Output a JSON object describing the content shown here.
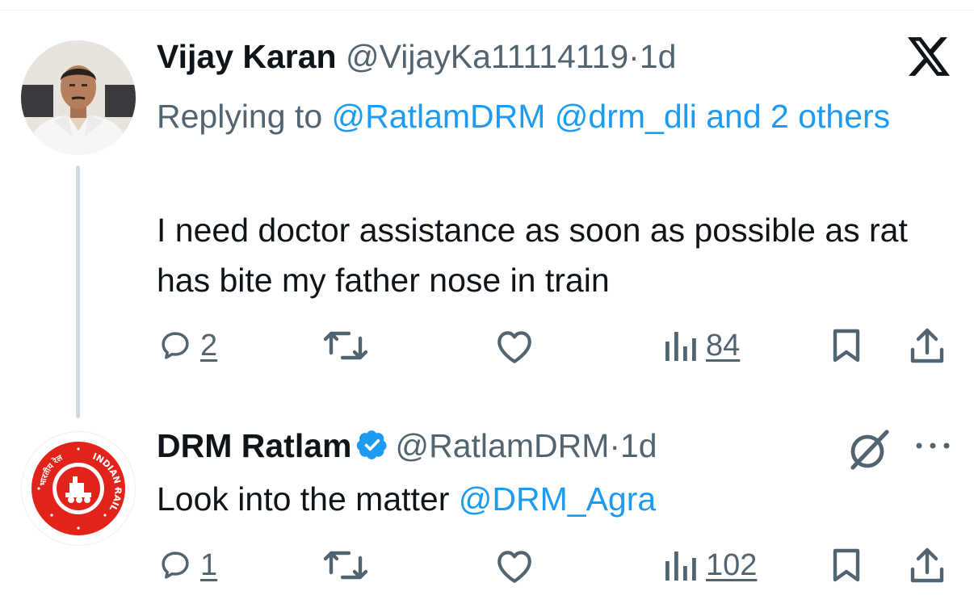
{
  "tweets": [
    {
      "display_name": "Vijay Karan",
      "handle": "@VijayKa11114119",
      "separator": "·",
      "time": "1d",
      "reply_prefix": "Replying to",
      "reply_mention_1": "@RatlamDRM",
      "reply_mention_2": "@drm_dli and 2 others",
      "text": "I need doctor assistance as soon as possible as rat has bite my father nose in train",
      "replies": "2",
      "views": "84",
      "icons": [
        "x-logo-icon",
        "reply-icon",
        "retweet-icon",
        "like-icon",
        "views-icon",
        "bookmark-icon",
        "share-icon"
      ]
    },
    {
      "display_name": "DRM Ratlam",
      "verified": true,
      "handle": "@RatlamDRM",
      "separator": "·",
      "time": "1d",
      "text_prefix": "Look into the matter",
      "text_mention": "@DRM_Agra",
      "replies": "1",
      "views": "102",
      "logo": {
        "text_english": "INDIAN RAILWAYS",
        "text_hindi": "भारतीय रेल"
      },
      "icons": [
        "grok-icon",
        "more-icon",
        "reply-icon",
        "retweet-icon",
        "like-icon",
        "views-icon",
        "bookmark-icon",
        "share-icon"
      ]
    }
  ],
  "colors": {
    "text": "#0f1419",
    "secondary": "#536471",
    "link": "#1d9bf0",
    "thread_line": "#cfd9de",
    "railway_red": "#e2231a"
  }
}
